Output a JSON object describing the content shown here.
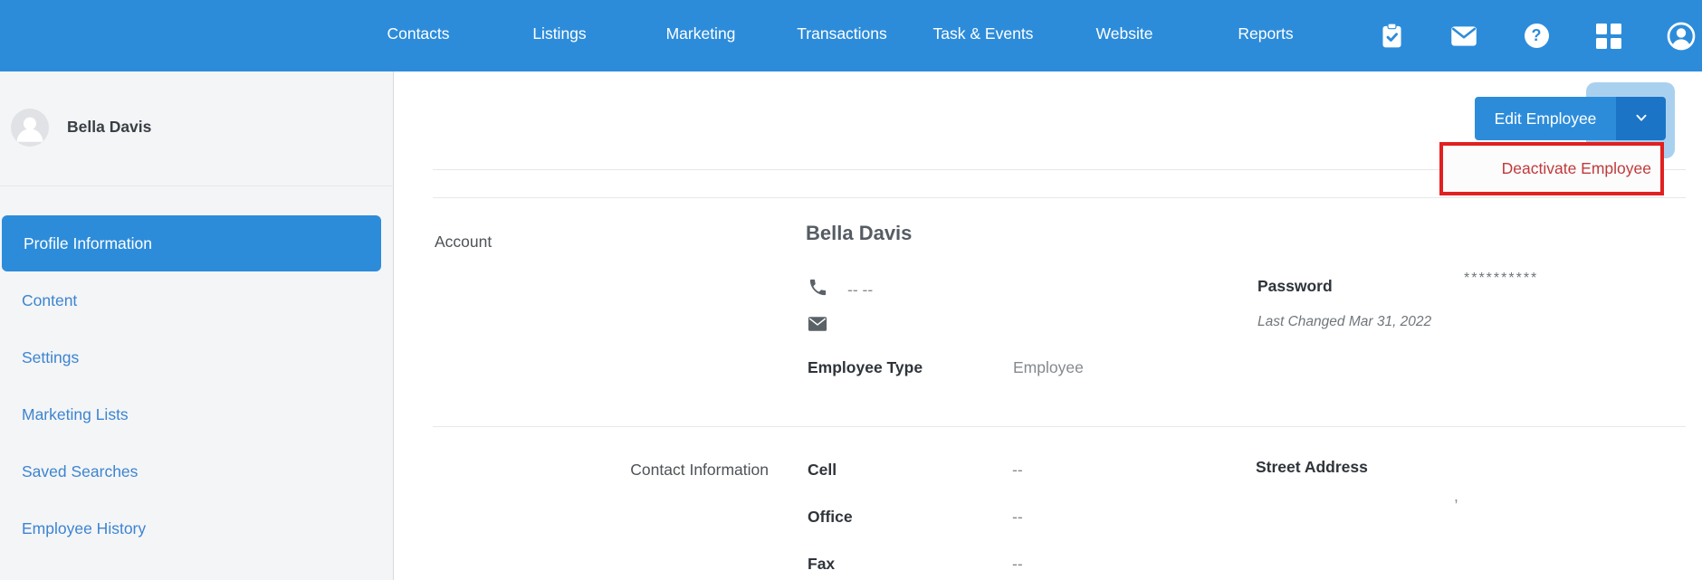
{
  "nav": {
    "items": [
      "Contacts",
      "Listings",
      "Marketing",
      "Transactions",
      "Task & Events",
      "Website",
      "Reports"
    ],
    "icons": [
      "clipboard-check-icon",
      "mail-icon",
      "help-icon",
      "apps-grid-icon",
      "account-icon"
    ]
  },
  "sidebar": {
    "user_name": "Bella Davis",
    "items": [
      "Profile Information",
      "Content",
      "Settings",
      "Marketing Lists",
      "Saved Searches",
      "Employee History"
    ],
    "active_item": "Profile Information"
  },
  "header": {
    "edit_button_label": "Edit Employee",
    "dropdown_item_label": "Deactivate Employee"
  },
  "account": {
    "section_label": "Account",
    "name": "Bella Davis",
    "phone_value": "-- --",
    "employee_type_label": "Employee Type",
    "employee_type_value": "Employee",
    "password_label": "Password",
    "password_value": "**********",
    "password_last_changed": "Last Changed Mar 31, 2022"
  },
  "contact": {
    "section_label": "Contact Information",
    "rows": [
      {
        "label": "Cell",
        "value": "--"
      },
      {
        "label": "Office",
        "value": "--"
      },
      {
        "label": "Fax",
        "value": "--"
      }
    ],
    "street_address_label": "Street Address",
    "street_address_value": ","
  },
  "colors": {
    "accent_blue": "#2d8cda",
    "dark_blue": "#1b74c6",
    "highlight_blue": "#a9d1ef",
    "link_blue": "#3c84d2",
    "annotation_red": "#e12020",
    "danger_text_red": "#c03a3a"
  }
}
